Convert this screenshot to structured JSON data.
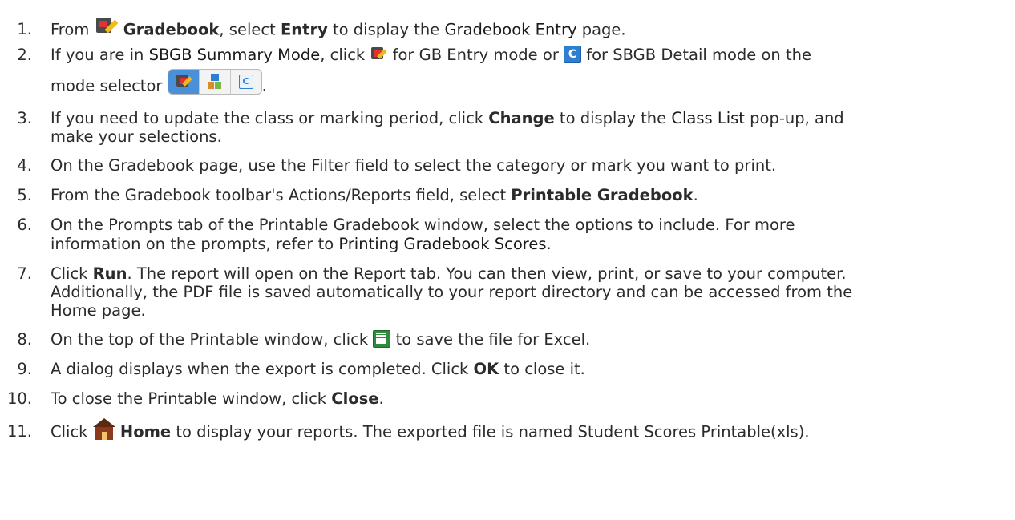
{
  "steps": [
    {
      "num": "1.",
      "parts": [
        "From ",
        "[gradebook-icon]",
        "Gradebook",
        ", select ",
        "Entry",
        " to display the ",
        "Gradebook Entry",
        " page."
      ]
    },
    {
      "num": "2.",
      "a": "If you are in ",
      "link": "SBGB Summary Mode",
      ", click ": "",
      "b": ", click ",
      "c": " for GB Entry mode or ",
      "d": " for SBGB Detail mode on the",
      "e": "mode selector",
      "f": "."
    },
    {
      "num": "3.",
      "a": "If you need to update the class or marking period, click ",
      "b": "Change",
      "c": " to display the ",
      "d": "Class List",
      "e": " pop-up, and",
      "f": "make your selections."
    },
    {
      "num": "4.",
      "a": "On the Gradebook page, use the Filter field to select the category or mark you want to print."
    },
    {
      "num": "5.",
      "a": "From the Gradebook toolbar's Actions/Reports field, select ",
      "b": "Printable Gradebook",
      "c": "."
    },
    {
      "num": "6.",
      "a": "On the Prompts tab of the Printable Gradebook window, select the options to include. For more",
      "b": "information on the prompts, refer to ",
      "c": "Printing Gradebook Scores",
      "d": "."
    },
    {
      "num": "7.",
      "a": "Click ",
      "b": "Run",
      ". The report will open on the Report tab. You can then view, print, or save to your computer.": "",
      "c": ". The report will open on the Report tab. You can then view, print, or save to your computer.",
      "d": "Additionally, the PDF file is saved automatically to your report directory and can be accessed from the",
      "e": "Home page."
    },
    {
      "num": "8.",
      "a": "On the top of the Printable window, click ",
      "b": " to save the file for Excel."
    },
    {
      "num": "9.",
      "a": "A dialog displays when the export is completed. Click ",
      "b": "OK",
      "c": " to close it."
    },
    {
      "num": "10.",
      "a": "To close the Printable window, click ",
      "b": "Close",
      "c": "."
    },
    {
      "num": "11.",
      "a": "Click ",
      "b": "Home",
      "c": " to display your reports. The exported file is named Student Scores Printable(xls)."
    }
  ],
  "icons": {
    "gradebook": "gradebook-icon",
    "gb_entry": "gb-entry-icon",
    "sbgb_detail": "sbgb-detail-icon",
    "mode_selector": "mode-selector",
    "excel": "excel-icon",
    "home": "home-icon"
  }
}
